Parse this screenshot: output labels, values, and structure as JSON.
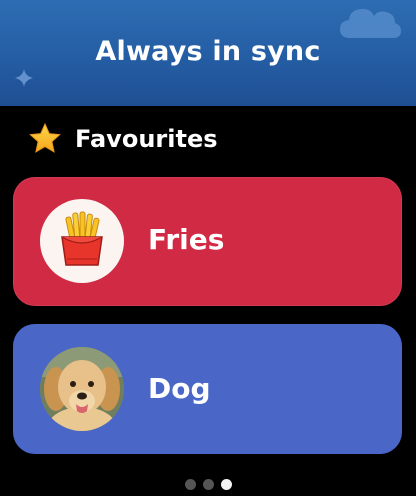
{
  "header": {
    "title": "Always in sync",
    "background_color": "#245da4",
    "cloud_icon": "cloud-icon",
    "sparkle_icon": "sparkle-icon"
  },
  "favourites": {
    "icon": "star-icon",
    "title": "Favourites",
    "items": [
      {
        "label": "Fries",
        "icon": "fries-icon",
        "color": "#d02a44"
      },
      {
        "label": "Dog",
        "icon": "dog-photo",
        "color": "#4a67c8"
      }
    ]
  },
  "pager": {
    "page_count": 3,
    "active_page": 3
  }
}
